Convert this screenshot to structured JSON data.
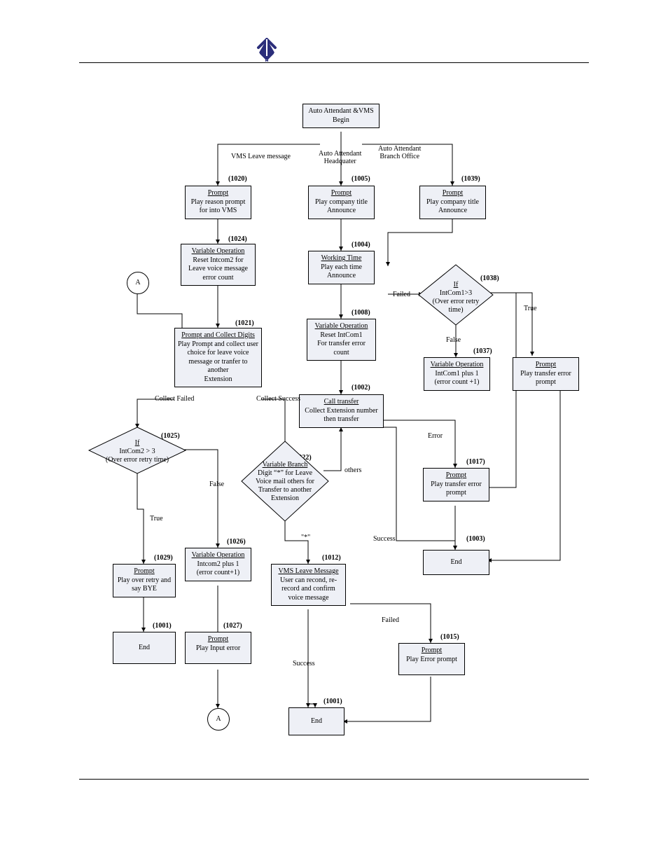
{
  "start": {
    "l1": "Auto Attendant &VMS",
    "l2": "Begin"
  },
  "edge": {
    "vms": "VMS Leave message",
    "hq": "Auto Attendant\nHeadquater",
    "br": "Auto Attendant\nBranch Office",
    "cfail": "Collect Failed",
    "csucc": "Collect Success",
    "others": "others",
    "star": "\"*\"",
    "true": "True",
    "false": "False",
    "error": "Error",
    "success": "Success",
    "failed": "Failed"
  },
  "conn": {
    "A": "A"
  },
  "n1020": {
    "id": "(1020)",
    "t": "Prompt",
    "l": [
      "Play reason prompt",
      "for into VMS"
    ]
  },
  "n1005": {
    "id": "(1005)",
    "t": "Prompt",
    "l": [
      "Play company title",
      "Announce"
    ]
  },
  "n1039": {
    "id": "(1039)",
    "t": "Prompt",
    "l": [
      "Play company title",
      "Announce"
    ]
  },
  "n1024": {
    "id": "(1024)",
    "t": "Variable Operation",
    "l": [
      "Reset Intcom2 for",
      "Leave voice message",
      "error count"
    ]
  },
  "n1004": {
    "id": "(1004)",
    "t": "Working Time",
    "l": [
      "Play each time",
      "Announce"
    ]
  },
  "n1038": {
    "id": "(1038)",
    "t": "If",
    "l": [
      "IntCom1>3",
      "(Over error retry",
      "time)"
    ]
  },
  "n1021": {
    "id": "(1021)",
    "t": "Prompt and Collect Digits",
    "l": [
      "Play Prompt and collect user",
      "choice for leave voice",
      "message or tranfer to another",
      "Extension"
    ]
  },
  "n1008": {
    "id": "(1008)",
    "t": "Variable Operation",
    "l": [
      "Reset IntCom1",
      "For transfer error",
      "count"
    ]
  },
  "n1037": {
    "id": "(1037)",
    "t": "Variable Operation",
    "l": [
      "IntCom1 plus 1",
      "(error count +1)"
    ]
  },
  "nPromptTE2": {
    "t": "Prompt",
    "l": [
      "Play transfer error",
      "prompt"
    ]
  },
  "n1002": {
    "id": "(1002)",
    "t": "Call transfer",
    "l": [
      "Collect Extension number",
      "then transfer"
    ]
  },
  "n1025": {
    "id": "(1025)",
    "t": "If",
    "l": [
      "IntCom2 > 3",
      "(Over error retry time)"
    ]
  },
  "n1022": {
    "id": "(1022)",
    "t": "Variable Branch",
    "l": [
      "Digit “*” for Leave",
      "Voice mail others for",
      "Transfer to another",
      "Extension"
    ]
  },
  "n1017": {
    "id": "(1017)",
    "t": "Prompt",
    "l": [
      "Play transfer error",
      "prompt"
    ]
  },
  "n1003": {
    "id": "(1003)",
    "l": [
      "End"
    ]
  },
  "n1029": {
    "id": "(1029)",
    "t": "Prompt",
    "l": [
      "Play over retry and",
      "say BYE"
    ]
  },
  "n1026": {
    "id": "(1026)",
    "t": "Variable Operation",
    "l": [
      "Intcom2 plus 1",
      "(error count+1)"
    ]
  },
  "n1012": {
    "id": "(1012)",
    "t": "VMS Leave Message",
    "l": [
      "User can recond, re-",
      "record and confirm",
      "voice message"
    ]
  },
  "n1001a": {
    "id": "(1001)",
    "l": [
      "End"
    ]
  },
  "n1027": {
    "id": "(1027)",
    "t": "Prompt",
    "l": [
      "Play Input error"
    ]
  },
  "n1015": {
    "id": "(1015)",
    "t": "Prompt",
    "l": [
      "Play Error prompt"
    ]
  },
  "n1001b": {
    "id": "(1001)",
    "l": [
      "End"
    ]
  }
}
